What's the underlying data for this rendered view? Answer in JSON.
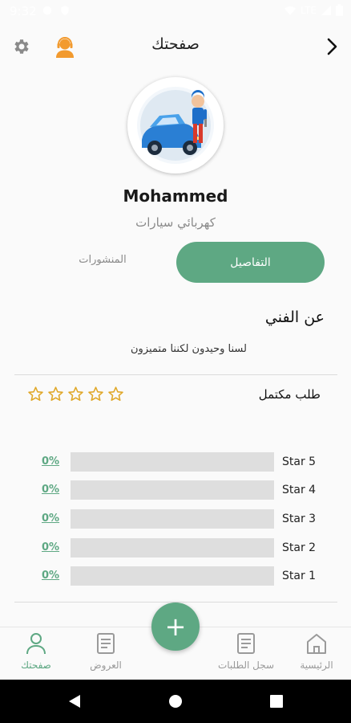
{
  "status_bar": {
    "time": "9:32",
    "network": "LTE"
  },
  "header": {
    "title": "صفحتك"
  },
  "profile": {
    "name": "Mohammed",
    "profession": "كهربائي سيارات"
  },
  "tabs": [
    {
      "label": "التفاصيل",
      "selected": true
    },
    {
      "label": "المنشورات",
      "selected": false
    }
  ],
  "about": {
    "title": "عن الفني",
    "text": "لسنا وحيدون لكننا متميزون"
  },
  "completed_requests": {
    "label": "طلب مكتمل",
    "stars_filled": 0,
    "stars_total": 5
  },
  "rating_breakdown": [
    {
      "label": "Star 5",
      "percent_text": "0%",
      "fraction": 0
    },
    {
      "label": "Star 4",
      "percent_text": "0%",
      "fraction": 0
    },
    {
      "label": "Star 3",
      "percent_text": "0%",
      "fraction": 0
    },
    {
      "label": "Star 2",
      "percent_text": "0%",
      "fraction": 0
    },
    {
      "label": "Star 1",
      "percent_text": "0%",
      "fraction": 0
    }
  ],
  "bottom_nav": [
    {
      "label": "صفحتك",
      "icon": "person-icon",
      "active": true
    },
    {
      "label": "العروض",
      "icon": "document-icon",
      "active": false
    },
    {
      "label": "سجل الطلبات",
      "icon": "document-icon",
      "active": false
    },
    {
      "label": "الرئيسية",
      "icon": "home-icon",
      "active": false
    }
  ],
  "fab": {
    "label": "+"
  },
  "colors": {
    "accent": "#5ea883",
    "star": "#e0a82a",
    "avatar_icon": "#f29a2e",
    "status_bar": "#000000"
  }
}
